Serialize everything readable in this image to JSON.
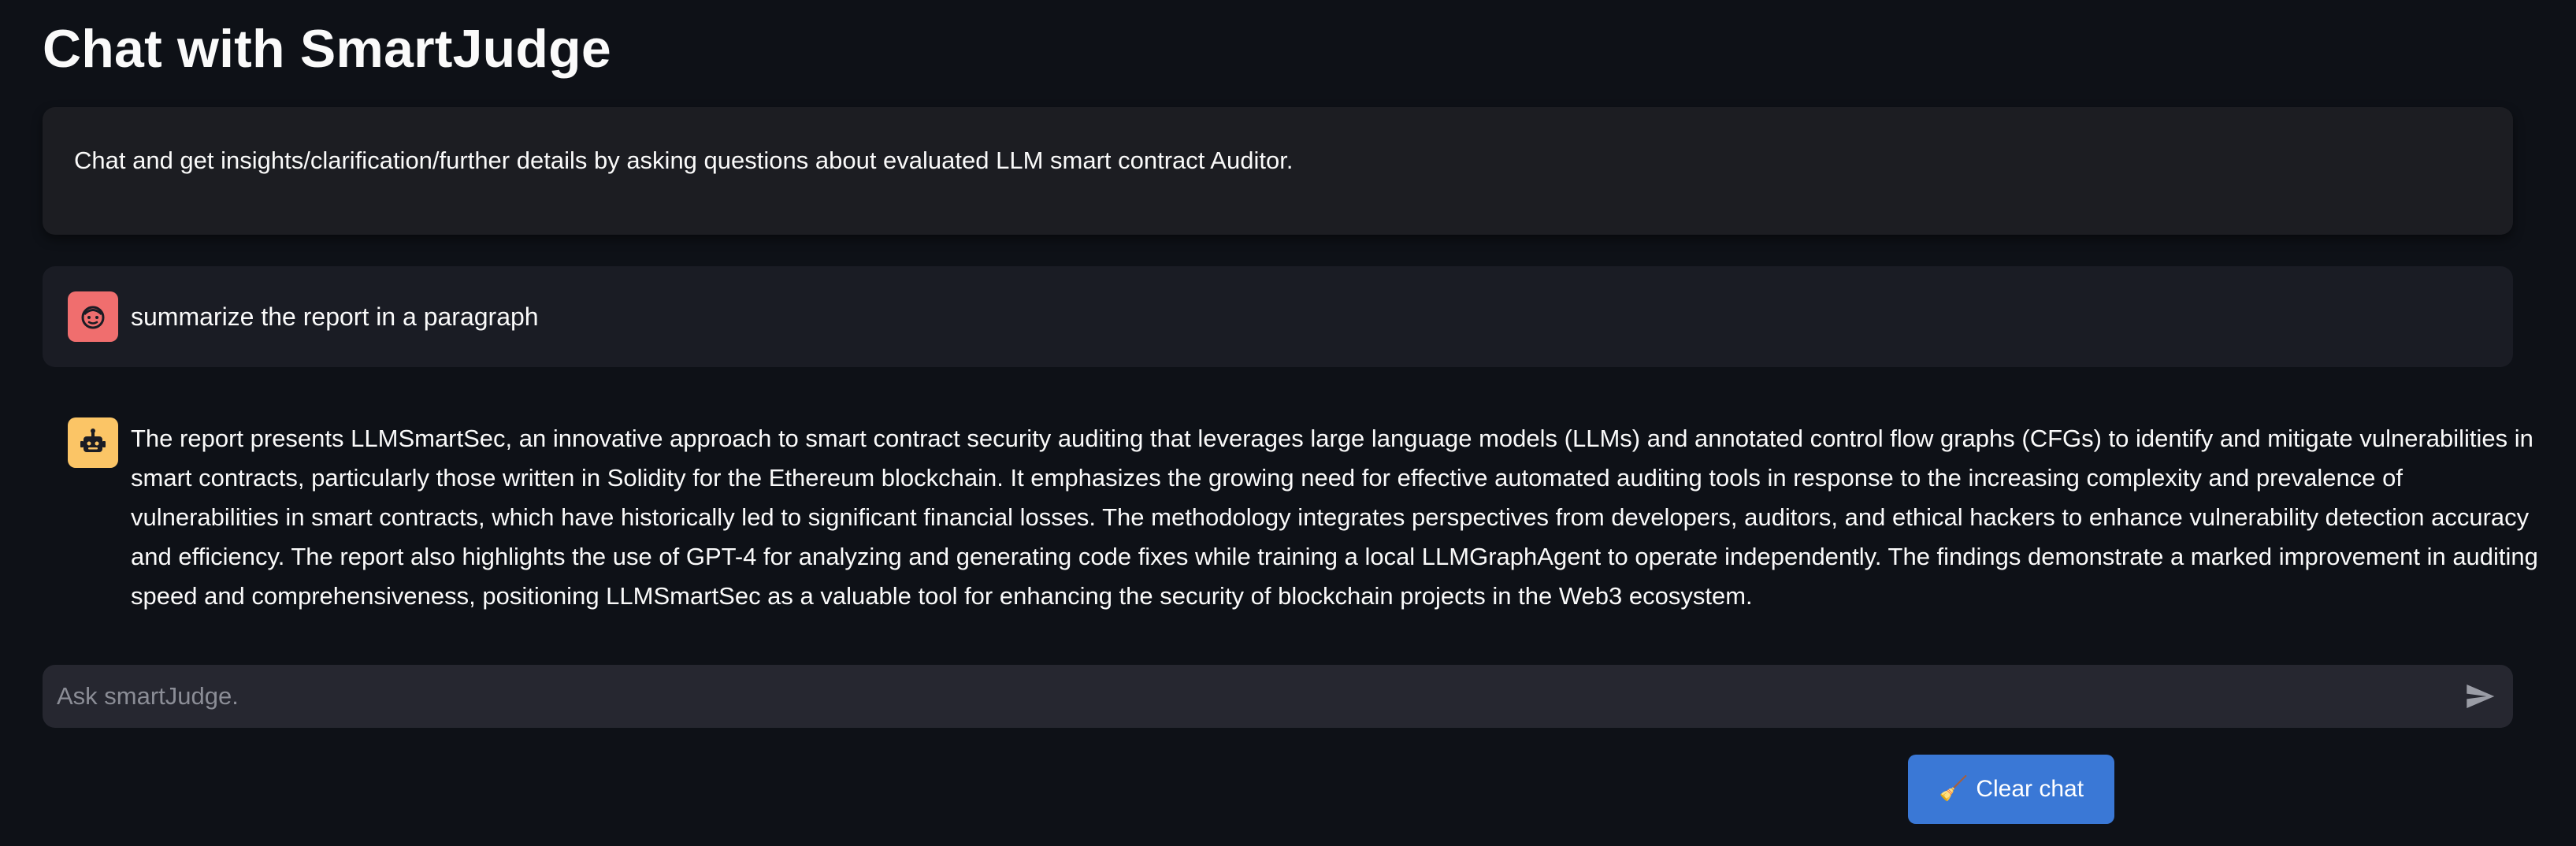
{
  "page": {
    "title": "Chat with SmartJudge"
  },
  "info": {
    "text": "Chat and get insights/clarification/further details by asking questions about evaluated LLM smart contract Auditor."
  },
  "messages": [
    {
      "role": "user",
      "avatar_icon": "user-face-icon",
      "text": "summarize the report in a paragraph"
    },
    {
      "role": "assistant",
      "avatar_icon": "robot-icon",
      "text": "The report presents LLMSmartSec, an innovative approach to smart contract security auditing that leverages large language models (LLMs) and annotated control flow graphs (CFGs) to identify and mitigate vulnerabilities in smart contracts, particularly those written in Solidity for the Ethereum blockchain. It emphasizes the growing need for effective automated auditing tools in response to the increasing complexity and prevalence of vulnerabilities in smart contracts, which have historically led to significant financial losses. The methodology integrates perspectives from developers, auditors, and ethical hackers to enhance vulnerability detection accuracy and efficiency. The report also highlights the use of GPT-4 for analyzing and generating code fixes while training a local LLMGraphAgent to operate independently. The findings demonstrate a marked improvement in auditing speed and comprehensiveness, positioning LLMSmartSec as a valuable tool for enhancing the security of blockchain projects in the Web3 ecosystem."
    }
  ],
  "chat_input": {
    "placeholder": "Ask smartJudge.",
    "value": "",
    "send_icon": "send-icon"
  },
  "clear_button": {
    "icon": "broom-icon",
    "label": "Clear chat"
  },
  "colors": {
    "background": "#0e1117",
    "user_avatar": "#f06e6e",
    "bot_avatar": "#fbc566",
    "button": "#3a78d6"
  }
}
